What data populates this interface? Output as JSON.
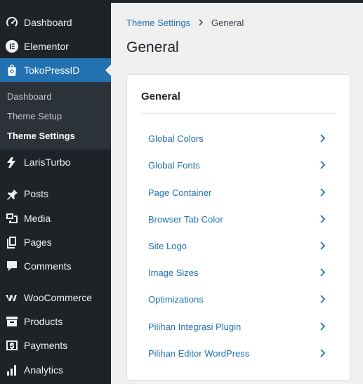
{
  "sidebar": {
    "items": [
      {
        "label": "Dashboard",
        "icon": "dashboard-gauge-icon"
      },
      {
        "label": "Elementor",
        "icon": "elementor-icon"
      },
      {
        "label": "TokoPressID",
        "icon": "shopping-bag-icon"
      },
      {
        "label": "LarisTurbo",
        "icon": "laristurbo-icon"
      },
      {
        "label": "Posts",
        "icon": "pushpin-icon"
      },
      {
        "label": "Media",
        "icon": "media-icon"
      },
      {
        "label": "Pages",
        "icon": "pages-icon"
      },
      {
        "label": "Comments",
        "icon": "comment-bubble-icon"
      },
      {
        "label": "WooCommerce",
        "icon": "woocommerce-icon"
      },
      {
        "label": "Products",
        "icon": "archive-box-icon"
      },
      {
        "label": "Payments",
        "icon": "dollar-icon"
      },
      {
        "label": "Analytics",
        "icon": "bar-chart-icon"
      }
    ],
    "submenu": [
      {
        "label": "Dashboard"
      },
      {
        "label": "Theme Setup"
      },
      {
        "label": "Theme Settings"
      }
    ]
  },
  "breadcrumb": {
    "parent": "Theme Settings",
    "current": "General"
  },
  "page_title": "General",
  "card": {
    "title": "General",
    "rows": [
      {
        "label": "Global Colors"
      },
      {
        "label": "Global Fonts"
      },
      {
        "label": "Page Container"
      },
      {
        "label": "Browser Tab Color"
      },
      {
        "label": "Site Logo"
      },
      {
        "label": "Image Sizes"
      },
      {
        "label": "Optimizations"
      },
      {
        "label": "Pilihan Integrasi Plugin"
      },
      {
        "label": "Pilihan Editor WordPress"
      }
    ]
  },
  "colors": {
    "sidebar_bg": "#1d2327",
    "submenu_bg": "#2c3338",
    "accent": "#2271b1",
    "link": "#2271b1"
  }
}
